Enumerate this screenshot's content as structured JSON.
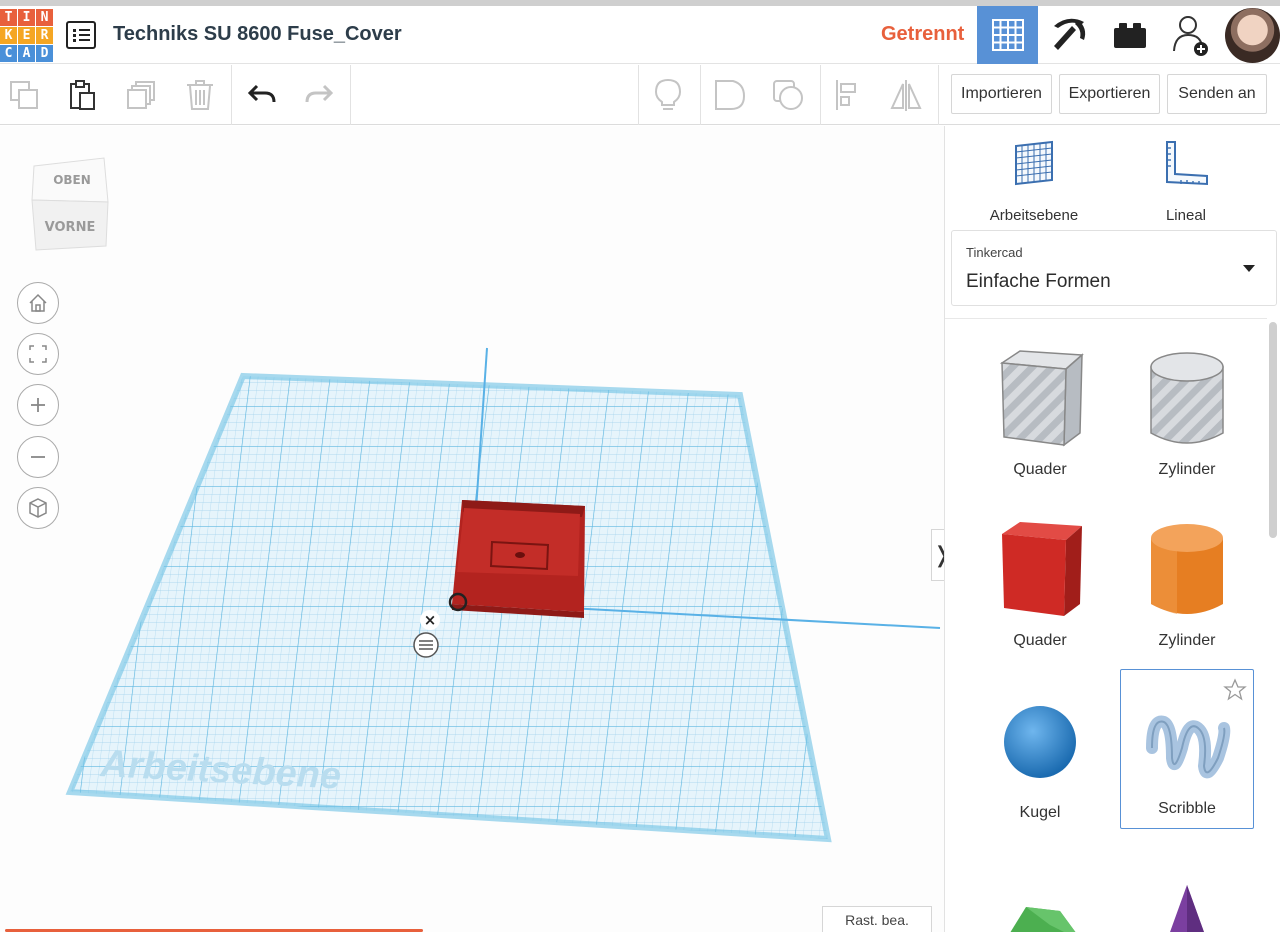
{
  "app": {
    "logo_letters": [
      "T",
      "I",
      "N",
      "K",
      "E",
      "R",
      "C",
      "A",
      "D"
    ],
    "logo_colors": [
      "#e8603c",
      "#e8603c",
      "#e8603c",
      "#f5a623",
      "#f5a623",
      "#f5a623",
      "#4a90d9",
      "#4a90d9",
      "#4a90d9"
    ],
    "project_title": "Techniks SU 8600 Fuse_Cover",
    "connection_status": "Getrennt",
    "status_color": "#e8603c",
    "accent_color": "#5891d6"
  },
  "topbar": {
    "icons": [
      "grid-view-icon",
      "pickaxe-icon",
      "brick-icon",
      "add-user-icon"
    ]
  },
  "toolbar": {
    "import_label": "Importieren",
    "export_label": "Exportieren",
    "send_label": "Senden an"
  },
  "viewport": {
    "navcube_top": "OBEN",
    "navcube_front": "VORNE",
    "workplane_watermark": "Arbeitsebene",
    "edit_grid_label": "Rast. bea."
  },
  "panel": {
    "workplane_label": "Arbeitsebene",
    "ruler_label": "Lineal",
    "library_category": "Tinkercad",
    "library_value": "Einfache Formen",
    "shapes": [
      {
        "name": "Quader",
        "color": "#c9cdd2"
      },
      {
        "name": "Zylinder",
        "color": "#c9cdd2"
      },
      {
        "name": "Quader",
        "color": "#d32f2f"
      },
      {
        "name": "Zylinder",
        "color": "#e67e22"
      },
      {
        "name": "Kugel",
        "color": "#2f8fd8"
      },
      {
        "name": "Scribble",
        "color": "#a9c4e0"
      }
    ]
  }
}
